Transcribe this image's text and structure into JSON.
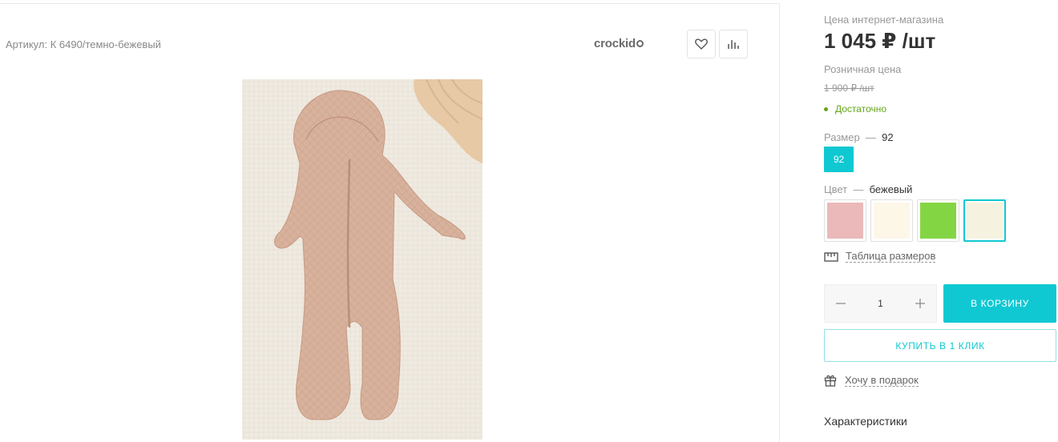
{
  "product": {
    "article": "Артикул: К 6490/темно-бежевый",
    "brand": "crockid"
  },
  "colors": {
    "accent": "#10c8d2",
    "stock": "#63a61a"
  },
  "buy": {
    "price_label": "Цена интернет-магазина",
    "price": "1 045 ₽ /шт",
    "retail_label": "Розничная цена",
    "retail_price": "1 900 ₽ /шт",
    "stock": "Достаточно",
    "size_label": "Размер",
    "size_dash": "—",
    "size_selected": "92",
    "sizes": [
      "92"
    ],
    "color_label": "Цвет",
    "color_dash": "—",
    "color_selected": "бежевый",
    "swatches": [
      "#ebb9b9",
      "#fdf7e8",
      "#84d544",
      "#f5f3df"
    ],
    "size_table": "Таблица размеров",
    "quantity": "1",
    "cart_button": "В КОРЗИНУ",
    "one_click_button": "КУПИТЬ В 1 КЛИК",
    "gift": "Хочу в подарок",
    "specs": "Характеристики"
  }
}
